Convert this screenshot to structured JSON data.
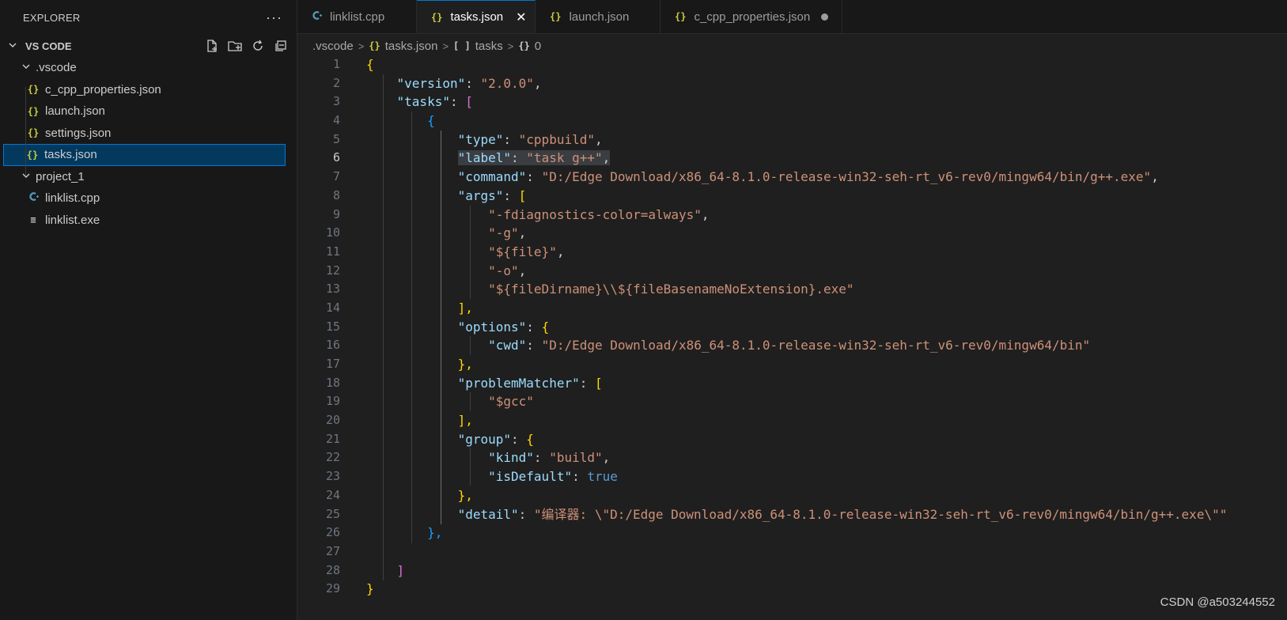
{
  "sidebar": {
    "title": "EXPLORER",
    "more": "···",
    "section": "VS CODE",
    "folders": [
      {
        "name": ".vscode",
        "files": [
          {
            "name": "c_cpp_properties.json",
            "icon": "{}"
          },
          {
            "name": "launch.json",
            "icon": "{}"
          },
          {
            "name": "settings.json",
            "icon": "{}"
          },
          {
            "name": "tasks.json",
            "icon": "{}",
            "selected": true
          }
        ]
      },
      {
        "name": "project_1",
        "files": [
          {
            "name": "linklist.cpp",
            "icon": "C++"
          },
          {
            "name": "linklist.exe",
            "icon": "≡"
          }
        ]
      }
    ]
  },
  "tabs": [
    {
      "label": "linklist.cpp",
      "icon": "C++"
    },
    {
      "label": "tasks.json",
      "icon": "{}",
      "active": true,
      "close": "✕"
    },
    {
      "label": "launch.json",
      "icon": "{}"
    },
    {
      "label": "c_cpp_properties.json",
      "icon": "{}",
      "dirty": true
    }
  ],
  "breadcrumb": {
    "folder": ".vscode",
    "file": "tasks.json",
    "node1": "tasks",
    "node1_icon": "[ ]",
    "node2": "0",
    "node2_icon": "{}"
  },
  "editor": {
    "current_line": 6,
    "line_numbers": [
      "1",
      "2",
      "3",
      "4",
      "5",
      "6",
      "7",
      "8",
      "9",
      "10",
      "11",
      "12",
      "13",
      "14",
      "15",
      "16",
      "17",
      "18",
      "19",
      "20",
      "21",
      "22",
      "23",
      "24",
      "25",
      "26",
      "27",
      "28",
      "29"
    ]
  },
  "code": {
    "open_brace": "{",
    "close_brace": "}",
    "version_key": "\"version\"",
    "version_val": "\"2.0.0\"",
    "tasks_key": "\"tasks\"",
    "tasks_open": "[",
    "tasks_close": "]",
    "task_open": "{",
    "task_close": "},",
    "type_key": "\"type\"",
    "type_val": "\"cppbuild\"",
    "label_key": "\"label\"",
    "label_val": "\"task g++\"",
    "command_key": "\"command\"",
    "command_val": "\"D:/Edge Download/x86_64-8.1.0-release-win32-seh-rt_v6-rev0/mingw64/bin/g++.exe\"",
    "args_key": "\"args\"",
    "args_open": "[",
    "args_close": "],",
    "args": [
      "\"-fdiagnostics-color=always\"",
      "\"-g\"",
      "\"${file}\"",
      "\"-o\"",
      "\"${fileDirname}\\\\${fileBasenameNoExtension}.exe\""
    ],
    "options_key": "\"options\"",
    "options_open": "{",
    "options_close": "},",
    "cwd_key": "\"cwd\"",
    "cwd_val": "\"D:/Edge Download/x86_64-8.1.0-release-win32-seh-rt_v6-rev0/mingw64/bin\"",
    "pm_key": "\"problemMatcher\"",
    "pm_open": "[",
    "pm_close": "],",
    "pm_val": "\"$gcc\"",
    "group_key": "\"group\"",
    "group_open": "{",
    "group_close": "},",
    "kind_key": "\"kind\"",
    "kind_val": "\"build\"",
    "isdefault_key": "\"isDefault\"",
    "isdefault_val": "true",
    "detail_key": "\"detail\"",
    "detail_val": "\"编译器: \\\"D:/Edge Download/x86_64-8.1.0-release-win32-seh-rt_v6-rev0/mingw64/bin/g++.exe\\\"\""
  },
  "watermark": "CSDN @a503244552",
  "colors": {
    "accent": "#0078d4",
    "json_icon": "#cbcb41",
    "cpp_icon": "#519aba",
    "string": "#ce9178",
    "key": "#9cdcfe"
  }
}
